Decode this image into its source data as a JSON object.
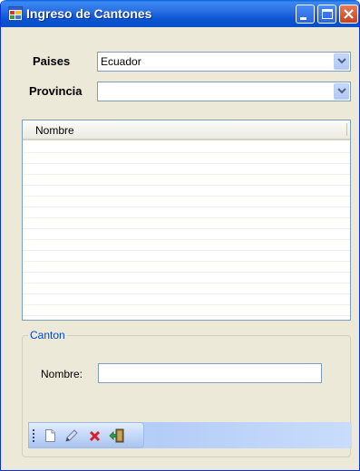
{
  "window": {
    "title": "Ingreso de Cantones",
    "icon": "form-icon",
    "controls": [
      "minimize-icon",
      "maximize-icon",
      "close-icon"
    ]
  },
  "filters": {
    "paises_label": "Paises",
    "paises_value": "Ecuador",
    "provincia_label": "Provincia",
    "provincia_value": ""
  },
  "grid": {
    "columns": [
      "Nombre"
    ],
    "rows": []
  },
  "canton": {
    "group_label": "Canton",
    "nombre_label": "Nombre:",
    "nombre_value": ""
  },
  "toolbar": {
    "items": [
      "new-document-icon",
      "edit-pencil-icon",
      "delete-x-icon",
      "exit-door-icon"
    ]
  },
  "colors": {
    "title_bar": "#0a55d3",
    "window_bg": "#ece9d8",
    "group_label": "#0046d5",
    "toolbar": "#c4dafa"
  }
}
